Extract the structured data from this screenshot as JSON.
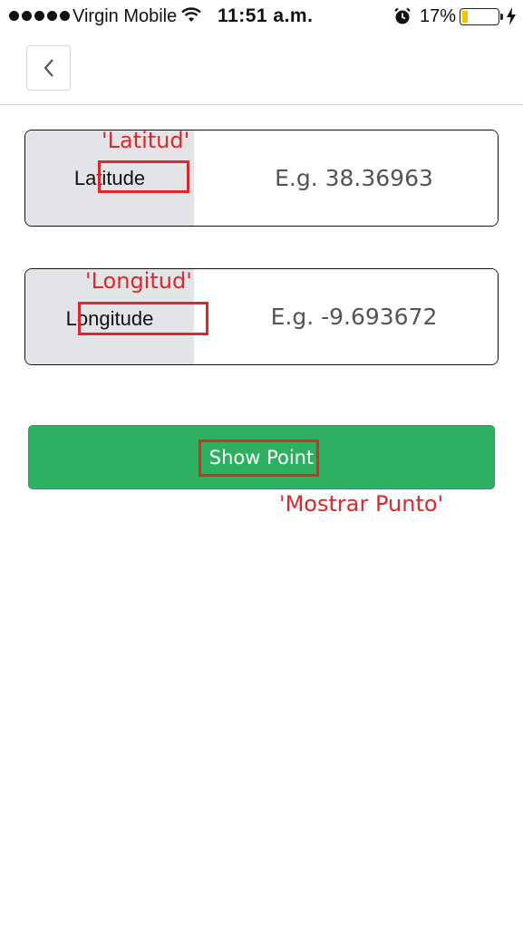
{
  "status_bar": {
    "carrier": "Virgin Mobile",
    "time": "11:51 a.m.",
    "battery_percent_label": "17%",
    "battery_level": 0.17,
    "icons": [
      "signal-dots-icon",
      "wifi-icon",
      "alarm-clock-icon",
      "battery-icon",
      "charging-bolt-icon"
    ]
  },
  "header": {
    "back_icon": "chevron-left-icon"
  },
  "latitude": {
    "label": "Latitude",
    "placeholder": "E.g. 38.36963",
    "value": "",
    "annotation": "'Latitud'"
  },
  "longitude": {
    "label": "Longitude",
    "placeholder": "E.g. -9.693672",
    "value": "",
    "annotation": "'Longitud'"
  },
  "show_point": {
    "label": "Show Point",
    "annotation": "'Mostrar Punto'"
  },
  "colors": {
    "button_green": "#2db05f",
    "addon_gray": "#e3e4e7",
    "annotation_red": "#e0262a",
    "battery_yellow": "#f5c400"
  }
}
